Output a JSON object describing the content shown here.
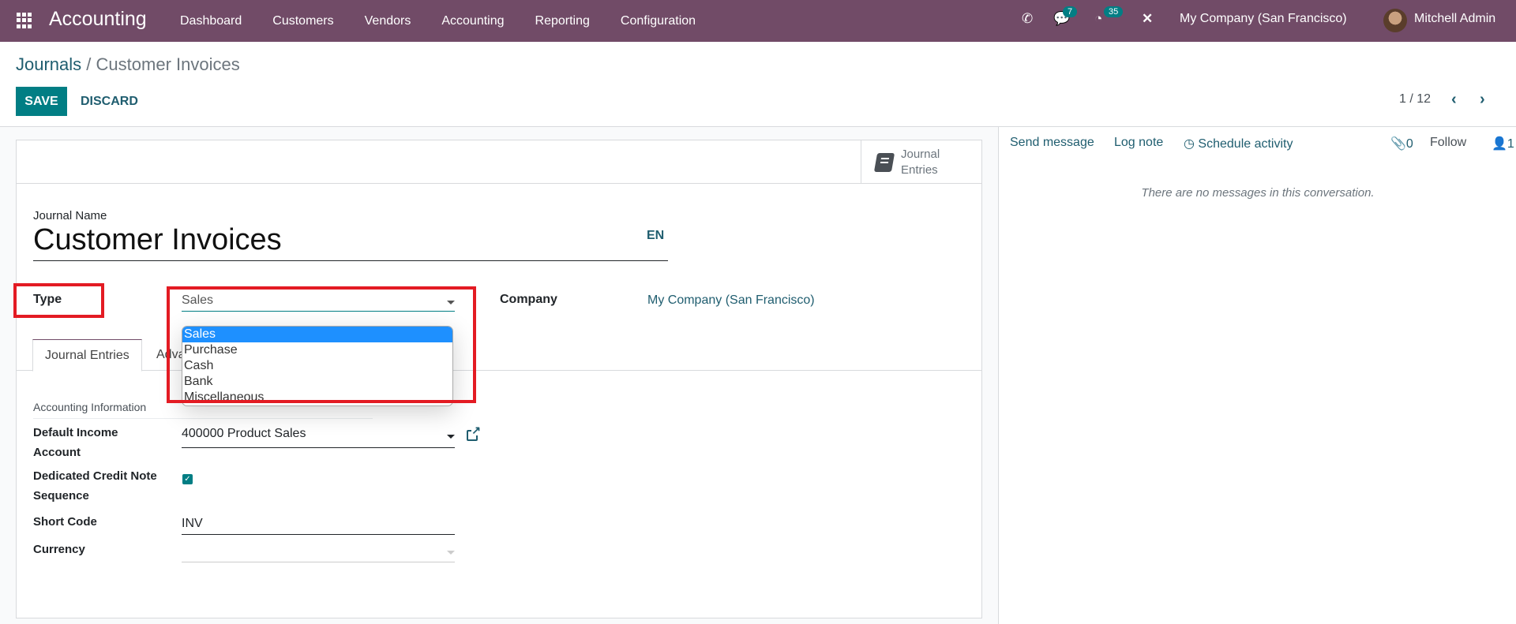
{
  "navbar": {
    "app_name": "Accounting",
    "menu": [
      "Dashboard",
      "Customers",
      "Vendors",
      "Accounting",
      "Reporting",
      "Configuration"
    ],
    "messages_count": "7",
    "activities_count": "35",
    "company": "My Company (San Francisco)",
    "user": "Mitchell Admin"
  },
  "breadcrumb": {
    "parent": "Journals",
    "separator": "/",
    "current": "Customer Invoices"
  },
  "toolbar": {
    "save_label": "SAVE",
    "discard_label": "DISCARD"
  },
  "pager": {
    "value": "1 / 12"
  },
  "form": {
    "smart_button": {
      "line1": "Journal",
      "line2": "Entries"
    },
    "journal_name_label": "Journal Name",
    "journal_name": "Customer Invoices",
    "lang": "EN",
    "type_label": "Type",
    "type_value": "Sales",
    "type_options": [
      "Sales",
      "Purchase",
      "Cash",
      "Bank",
      "Miscellaneous"
    ],
    "type_selected_index": 0,
    "company_label": "Company",
    "company_value": "My Company (San Francisco)",
    "tabs": [
      "Journal Entries",
      "Advanced Settings"
    ],
    "tab_visible_fragment": "Adva",
    "section_title": "Accounting Information",
    "default_income_label_1": "Default Income",
    "default_income_label_2": "Account",
    "default_income_value": "400000 Product Sales",
    "credit_note_label_1": "Dedicated Credit Note",
    "credit_note_label_2": "Sequence",
    "credit_note_checked": true,
    "short_code_label": "Short Code",
    "short_code_value": "INV",
    "currency_label": "Currency",
    "currency_value": ""
  },
  "chatter": {
    "send_message": "Send message",
    "log_note": "Log note",
    "schedule_activity": "Schedule activity",
    "attachments_count": "0",
    "follow": "Follow",
    "followers_count": "1",
    "empty_text": "There are no messages in this conversation."
  },
  "colors": {
    "brand": "#714b67",
    "primary": "#017e84",
    "highlight": "#e31b23",
    "selected_option": "#1e90ff"
  }
}
